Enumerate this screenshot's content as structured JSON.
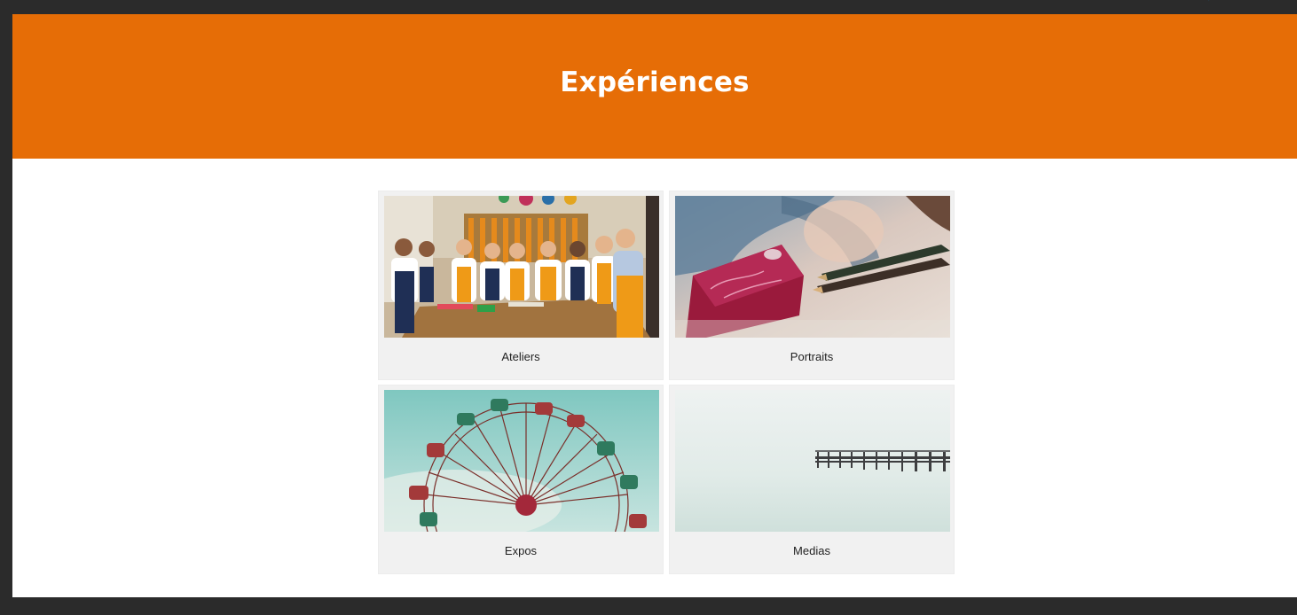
{
  "hero": {
    "title": "Expériences",
    "background": "#e66d06"
  },
  "cards": [
    {
      "label": "Ateliers",
      "image": "workshop-photo"
    },
    {
      "label": "Portraits",
      "image": "painting-pencils-photo"
    },
    {
      "label": "Expos",
      "image": "ferris-wheel-photo"
    },
    {
      "label": "Medias",
      "image": "misty-pier-photo"
    }
  ],
  "colors": {
    "accent": "#e66d06",
    "card_bg": "#f1f1f1",
    "frame": "#2b2b2b"
  }
}
